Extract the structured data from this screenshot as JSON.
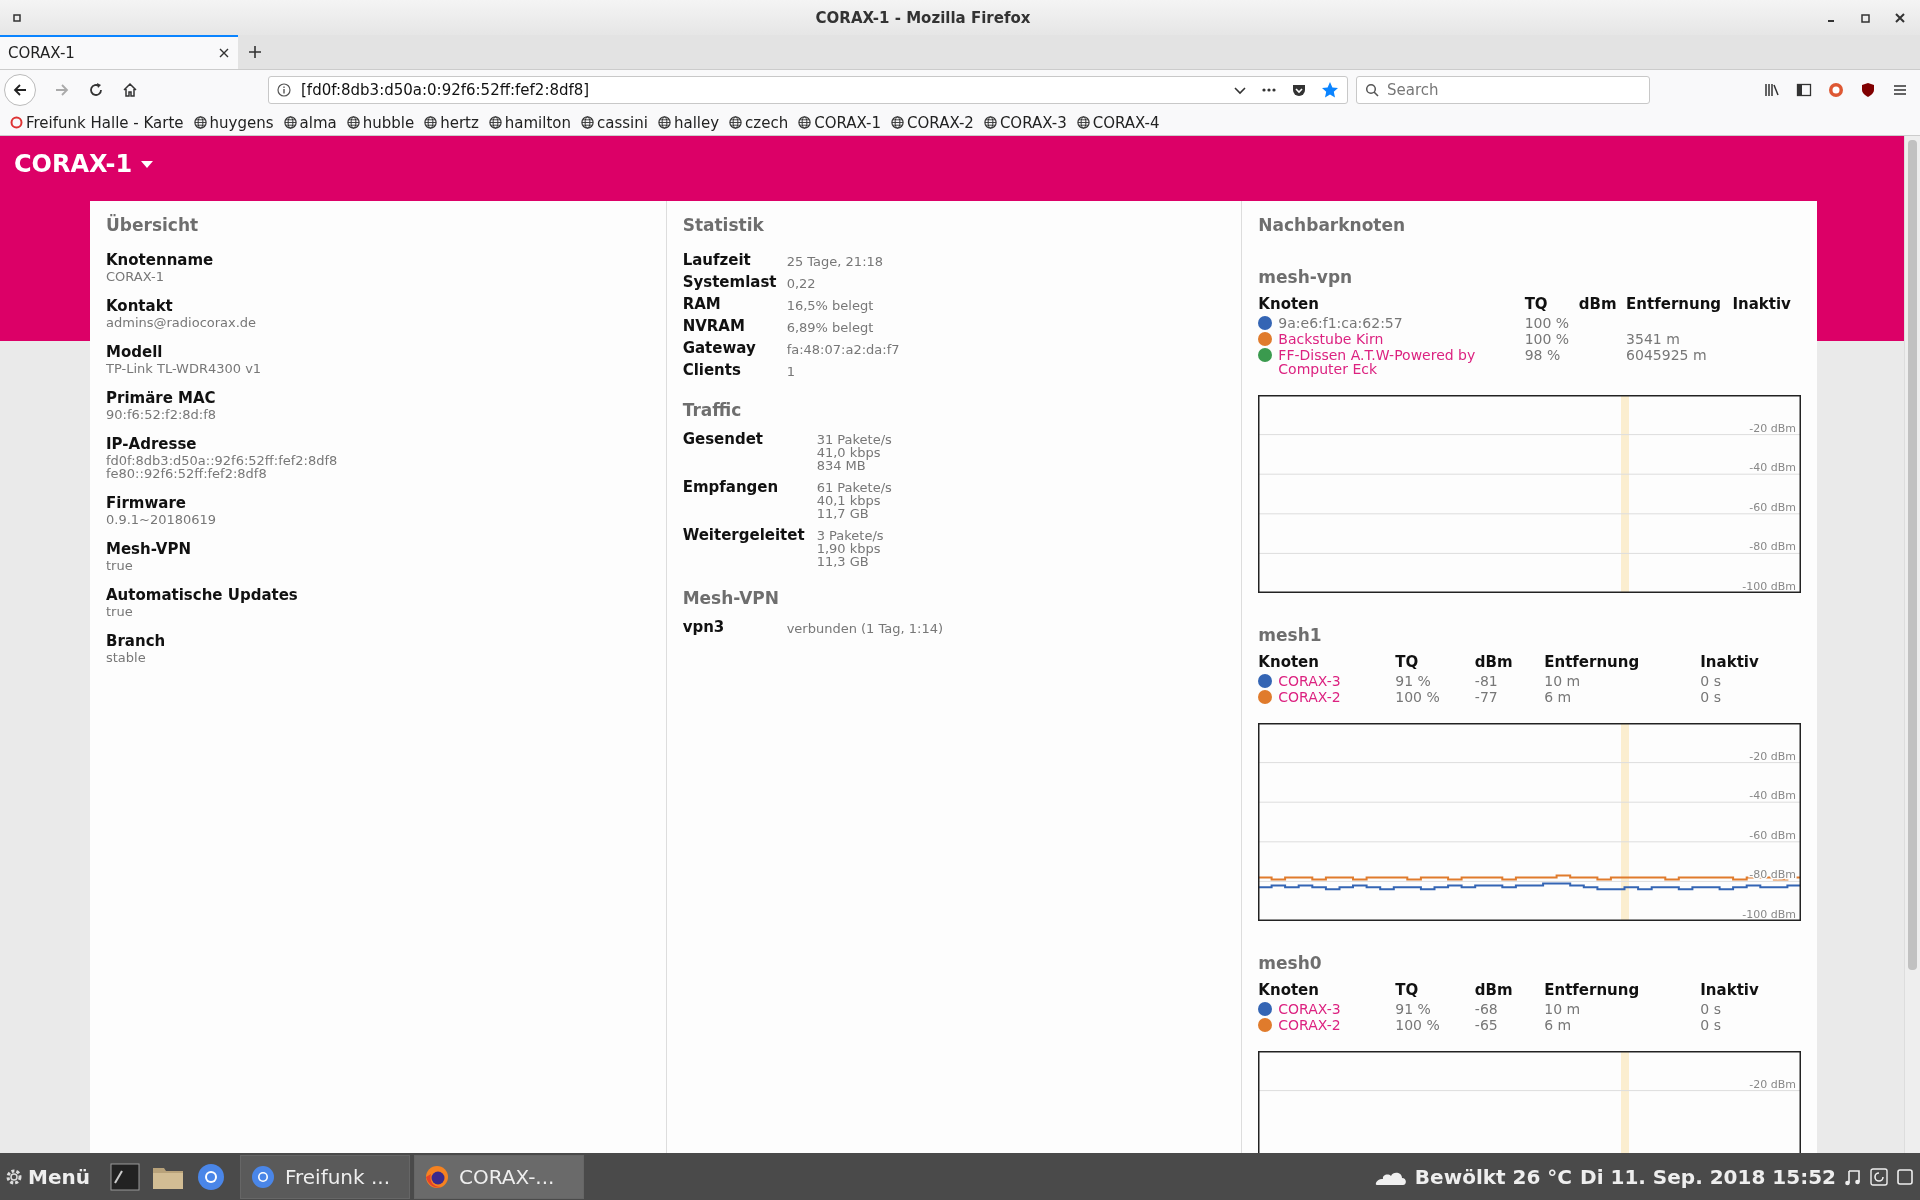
{
  "window": {
    "title": "CORAX-1 - Mozilla Firefox"
  },
  "tabs": [
    {
      "label": "CORAX-1",
      "selected": true
    }
  ],
  "address_bar": {
    "value": "[fd0f:8db3:d50a:0:92f6:52ff:fef2:8df8]"
  },
  "search": {
    "placeholder": "Search"
  },
  "bookmarks": [
    {
      "label": "Freifunk Halle - Karte",
      "kind": "site"
    },
    {
      "label": "huygens",
      "kind": "globe"
    },
    {
      "label": "alma",
      "kind": "globe"
    },
    {
      "label": "hubble",
      "kind": "globe"
    },
    {
      "label": "hertz",
      "kind": "globe"
    },
    {
      "label": "hamilton",
      "kind": "globe"
    },
    {
      "label": "cassini",
      "kind": "globe"
    },
    {
      "label": "halley",
      "kind": "globe"
    },
    {
      "label": "czech",
      "kind": "globe"
    },
    {
      "label": "CORAX-1",
      "kind": "globe"
    },
    {
      "label": "CORAX-2",
      "kind": "globe"
    },
    {
      "label": "CORAX-3",
      "kind": "globe"
    },
    {
      "label": "CORAX-4",
      "kind": "globe"
    }
  ],
  "page": {
    "node_title": "CORAX-1",
    "overview": {
      "title": "Übersicht",
      "items": [
        {
          "label": "Knotenname",
          "lines": [
            "CORAX-1"
          ]
        },
        {
          "label": "Kontakt",
          "lines": [
            "admins@radiocorax.de"
          ]
        },
        {
          "label": "Modell",
          "lines": [
            "TP-Link TL-WDR4300 v1"
          ]
        },
        {
          "label": "Primäre MAC",
          "lines": [
            "90:f6:52:f2:8d:f8"
          ]
        },
        {
          "label": "IP-Adresse",
          "lines": [
            "fd0f:8db3:d50a::92f6:52ff:fef2:8df8",
            "fe80::92f6:52ff:fef2:8df8"
          ]
        },
        {
          "label": "Firmware",
          "lines": [
            "0.9.1~20180619"
          ]
        },
        {
          "label": "Mesh-VPN",
          "lines": [
            "true"
          ]
        },
        {
          "label": "Automatische Updates",
          "lines": [
            "true"
          ]
        },
        {
          "label": "Branch",
          "lines": [
            "stable"
          ]
        }
      ]
    },
    "statistics": [
      {
        "title": "Statistik",
        "rows": [
          {
            "label": "Laufzeit",
            "lines": [
              "25 Tage, 21:18"
            ]
          },
          {
            "label": "Systemlast",
            "lines": [
              "0,22"
            ]
          },
          {
            "label": "RAM",
            "lines": [
              "16,5% belegt"
            ]
          },
          {
            "label": "NVRAM",
            "lines": [
              "6,89% belegt"
            ]
          },
          {
            "label": "Gateway",
            "lines": [
              "fa:48:07:a2:da:f7"
            ]
          },
          {
            "label": "Clients",
            "lines": [
              "1"
            ]
          }
        ]
      },
      {
        "title": "Traffic",
        "rows": [
          {
            "label": "Gesendet",
            "lines": [
              "31 Pakete/s",
              "41,0 kbps",
              "834 MB"
            ]
          },
          {
            "label": "Empfangen",
            "lines": [
              "61 Pakete/s",
              "40,1 kbps",
              "11,7 GB"
            ]
          },
          {
            "label": "Weitergeleitet",
            "lines": [
              "3 Pakete/s",
              "1,90 kbps",
              "11,3 GB"
            ]
          }
        ]
      },
      {
        "title": "Mesh-VPN",
        "rows": [
          {
            "label": "vpn3",
            "lines": [
              "verbunden (1 Tag, 1:14)"
            ]
          }
        ]
      }
    ],
    "neighbours": {
      "title": "Nachbarknoten",
      "interfaces": [
        {
          "name": "mesh-vpn",
          "columns": [
            "Knoten",
            "TQ",
            "dBm",
            "Entfernung",
            "Inaktiv"
          ],
          "rows": [
            {
              "color": "#3465b4",
              "node": "9a:e6:f1:ca:62:57",
              "link": false,
              "tq": "100 %"
            },
            {
              "color": "#e07b2c",
              "node": "Backstube Kirn",
              "link": true,
              "tq": "100 %",
              "distance": "3541 m"
            },
            {
              "color": "#3a9a4e",
              "node": "FF-Dissen A.T.W-Powered by Computer Eck",
              "link": true,
              "tq": "98 %",
              "distance": "6045925 m"
            }
          ],
          "graph": {
            "y_labels": [
              "-20 dBm",
              "-40 dBm",
              "-60 dBm",
              "-80 dBm",
              "-100 dBm"
            ]
          }
        },
        {
          "name": "mesh1",
          "columns": [
            "Knoten",
            "TQ",
            "dBm",
            "Entfernung",
            "Inaktiv"
          ],
          "rows": [
            {
              "color": "#3465b4",
              "node": "CORAX-3",
              "link": true,
              "tq": "91 %",
              "dbm": "-81",
              "distance": "10 m",
              "inactive": "0 s"
            },
            {
              "color": "#e07b2c",
              "node": "CORAX-2",
              "link": true,
              "tq": "100 %",
              "dbm": "-77",
              "distance": "6 m",
              "inactive": "0 s"
            }
          ],
          "chart_data": {
            "type": "line",
            "grid": true,
            "ylim": [
              -100,
              0
            ],
            "yticks": [
              {
                "value": -20,
                "label": "-20 dBm"
              },
              {
                "value": -40,
                "label": "-40 dBm"
              },
              {
                "value": -60,
                "label": "-60 dBm"
              },
              {
                "value": -80,
                "label": "-80 dBm"
              },
              {
                "value": -100,
                "label": "-100 dBm"
              }
            ],
            "series": [
              {
                "color": "#e07b2c",
                "values": [
                  -78,
                  -79,
                  -78,
                  -78,
                  -79,
                  -78,
                  -78,
                  -79,
                  -78,
                  -78,
                  -78,
                  -79,
                  -78,
                  -78,
                  -79,
                  -78,
                  -78,
                  -78,
                  -79,
                  -78,
                  -78,
                  -78,
                  -77,
                  -78,
                  -78,
                  -79,
                  -78,
                  -78,
                  -78,
                  -78,
                  -79,
                  -78,
                  -78,
                  -78,
                  -78,
                  -79,
                  -78,
                  -78,
                  -79,
                  -78
                ]
              },
              {
                "color": "#3465b4",
                "values": [
                  -83,
                  -82,
                  -83,
                  -82,
                  -83,
                  -84,
                  -83,
                  -82,
                  -83,
                  -84,
                  -83,
                  -83,
                  -84,
                  -83,
                  -82,
                  -83,
                  -82,
                  -82,
                  -83,
                  -82,
                  -82,
                  -81,
                  -81,
                  -82,
                  -83,
                  -84,
                  -84,
                  -83,
                  -84,
                  -83,
                  -83,
                  -84,
                  -83,
                  -83,
                  -84,
                  -83,
                  -82,
                  -83,
                  -83,
                  -82
                ]
              }
            ]
          }
        },
        {
          "name": "mesh0",
          "columns": [
            "Knoten",
            "TQ",
            "dBm",
            "Entfernung",
            "Inaktiv"
          ],
          "rows": [
            {
              "color": "#3465b4",
              "node": "CORAX-3",
              "link": true,
              "tq": "91 %",
              "dbm": "-68",
              "distance": "10 m",
              "inactive": "0 s"
            },
            {
              "color": "#e07b2c",
              "node": "CORAX-2",
              "link": true,
              "tq": "100 %",
              "dbm": "-65",
              "distance": "6 m",
              "inactive": "0 s"
            }
          ],
          "graph": {
            "y_labels": [
              "-20 dBm"
            ]
          }
        }
      ]
    }
  },
  "taskbar": {
    "menu": "Menü",
    "tasks": [
      {
        "label": "Freifunk ...",
        "kind": "browser-round",
        "selected": false
      },
      {
        "label": "CORAX-...",
        "kind": "browser-fox",
        "selected": true
      }
    ],
    "weather": "Bewölkt 26 °C",
    "clock": "Di 11. Sep. 2018 15:52"
  }
}
